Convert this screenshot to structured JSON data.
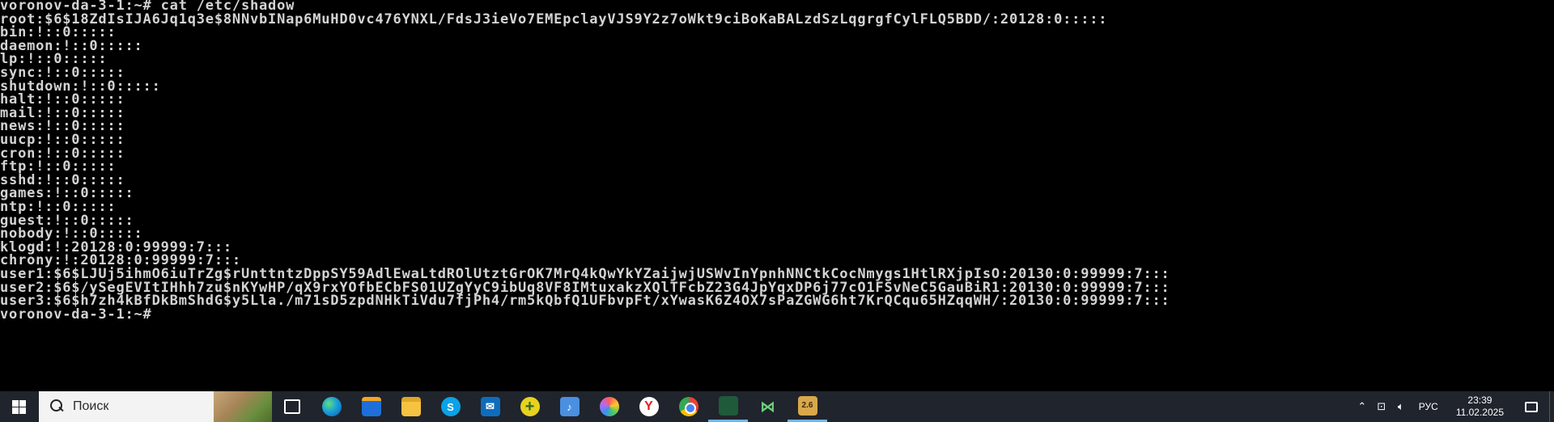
{
  "terminal": {
    "lines": [
      "voronov-da-3-1:~# cat /etc/shadow",
      "root:$6$18ZdIsIJA6Jq1q3e$8NNvbINap6MuHD0vc476YNXL/FdsJ3ieVo7EMEpclayVJS9Y2z7oWkt9ciBoKaBALzdSzLqgrgfCylFLQ5BDD/:20128:0:::::",
      "bin:!::0:::::",
      "daemon:!::0:::::",
      "lp:!::0:::::",
      "sync:!::0:::::",
      "shutdown:!::0:::::",
      "halt:!::0:::::",
      "mail:!::0:::::",
      "news:!::0:::::",
      "uucp:!::0:::::",
      "cron:!::0:::::",
      "ftp:!::0:::::",
      "sshd:!::0:::::",
      "games:!::0:::::",
      "ntp:!::0:::::",
      "guest:!::0:::::",
      "nobody:!::0:::::",
      "klogd:!:20128:0:99999:7:::",
      "chrony:!:20128:0:99999:7:::",
      "user1:$6$LJUj5ihmO6iuTrZg$rUnttntzDppSY59AdlEwaLtdROlUtztGrOK7MrQ4kQwYkYZaijwjUSWvInYpnhNNCtkCocNmygs1HtlRXjpIsO:20130:0:99999:7:::",
      "user2:$6$/ySegEVItIHhh7zu$nKYwHP/qX9rxYOfbECbFS01UZgYyC9ibUq8VF8IMtuxakzXQlTFcbZ23G4JpYqxDP6j77cO1FSvNeC5GauBiR1:20130:0:99999:7:::",
      "user3:$6$h7zh4kBfDkBmShdG$y5Lla./m71sD5zpdNHkTiVdu7fjPh4/rm5kQbfQ1UFbvpFt/xYwasK6Z4OX7sPaZGWG6ht7KrQCqu65HZqqWH/:20130:0:99999:7:::",
      "voronov-da-3-1:~#"
    ]
  },
  "taskbar": {
    "search_placeholder": "Поиск",
    "apps": [
      {
        "name": "task-view-icon",
        "glyph": ""
      },
      {
        "name": "edge-icon",
        "glyph": ""
      },
      {
        "name": "store-icon",
        "glyph": ""
      },
      {
        "name": "file-explorer-icon",
        "glyph": ""
      },
      {
        "name": "skype-icon",
        "glyph": "S"
      },
      {
        "name": "mail-icon",
        "glyph": "✉"
      },
      {
        "name": "plus-app-icon",
        "glyph": "+"
      },
      {
        "name": "audio-app-icon",
        "glyph": "♪"
      },
      {
        "name": "photos-icon",
        "glyph": ""
      },
      {
        "name": "yandex-browser-icon",
        "glyph": "Y"
      },
      {
        "name": "chrome-icon",
        "glyph": ""
      },
      {
        "name": "terminal-app-icon",
        "glyph": ""
      },
      {
        "name": "vscode-icon",
        "glyph": "⋈"
      },
      {
        "name": "virtualbox-icon",
        "glyph": "2.6"
      }
    ],
    "tray": {
      "chevron": "⌃",
      "network": "⊡",
      "volume": "🔈︎",
      "language": "РУС",
      "time": "23:39",
      "date": "11.02.2025"
    }
  }
}
